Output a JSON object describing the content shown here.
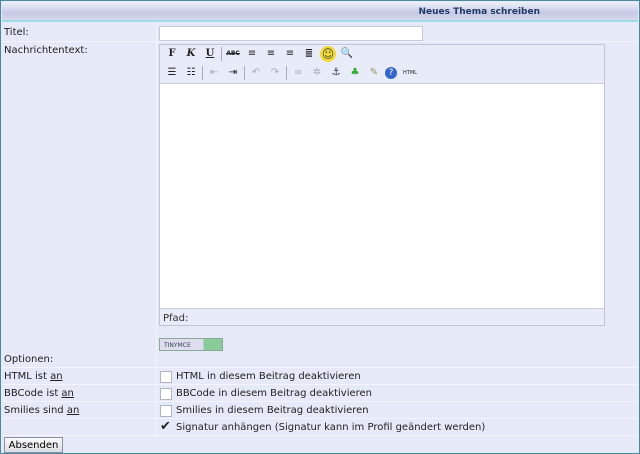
{
  "header": {
    "title": "Neues Thema schreiben"
  },
  "form": {
    "title_label": "Titel:",
    "title_value": "",
    "message_label": "Nachrichtentext:",
    "path_label": "Pfad:",
    "badge": "TINYMCE",
    "options_label": "Optionen:",
    "options": [
      {
        "status_prefix": "HTML ist ",
        "status_link": "an",
        "label": "HTML in diesem Beitrag deaktivieren",
        "checked": false
      },
      {
        "status_prefix": "BBCode ist ",
        "status_link": "an",
        "label": "BBCode in diesem Beitrag deaktivieren",
        "checked": false
      },
      {
        "status_prefix": "Smilies sind ",
        "status_link": "an",
        "label": "Smilies in diesem Beitrag deaktivieren",
        "checked": false
      },
      {
        "status_prefix": "",
        "status_link": "",
        "label": "Signatur anhängen (Signatur kann im Profil geändert werden)",
        "checked": true
      }
    ],
    "submit": "Absenden"
  },
  "toolbar": {
    "bold": "F",
    "italic": "K",
    "underline": "U",
    "strike": "ABC",
    "smiley": "☺",
    "html": "HTML"
  }
}
